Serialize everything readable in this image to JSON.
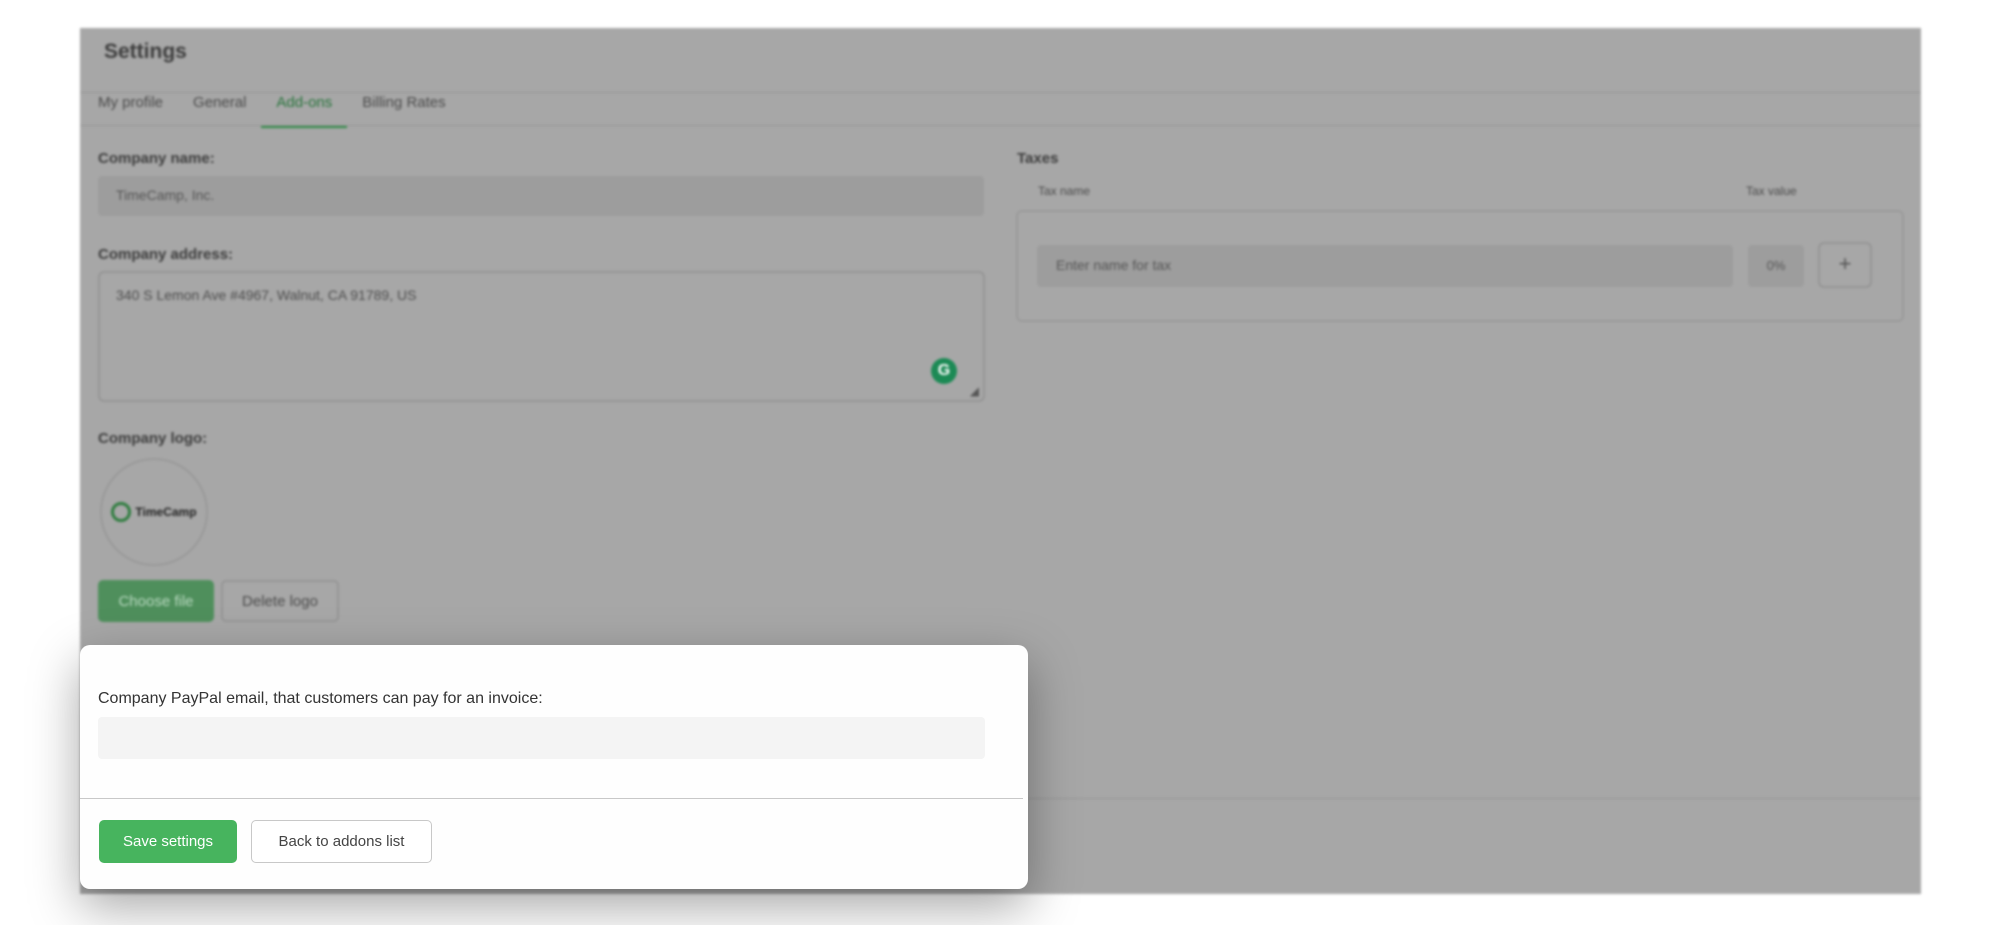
{
  "header": {
    "title": "Settings"
  },
  "tabs": [
    {
      "label": "My profile",
      "active": false
    },
    {
      "label": "General",
      "active": false
    },
    {
      "label": "Add-ons",
      "active": true
    },
    {
      "label": "Billing Rates",
      "active": false
    }
  ],
  "company": {
    "name_label": "Company name:",
    "name_value": "TimeCamp, Inc.",
    "address_label": "Company address:",
    "address_value": "340 S Lemon Ave #4967, Walnut, CA 91789, US",
    "logo_label": "Company logo:",
    "logo_text": "TimeCamp",
    "choose_file": "Choose file",
    "delete_logo": "Delete logo"
  },
  "taxes": {
    "title": "Taxes",
    "col_name": "Tax name",
    "col_value": "Tax value",
    "name_placeholder": "Enter name for tax",
    "value": "0%",
    "add": "+"
  },
  "modal": {
    "paypal_label": "Company PayPal email, that customers can pay for an invoice:",
    "paypal_value": "",
    "save": "Save settings",
    "back": "Back to addons list"
  },
  "colors": {
    "accent": "#47b45e",
    "overlay": "#a7a7a7"
  }
}
